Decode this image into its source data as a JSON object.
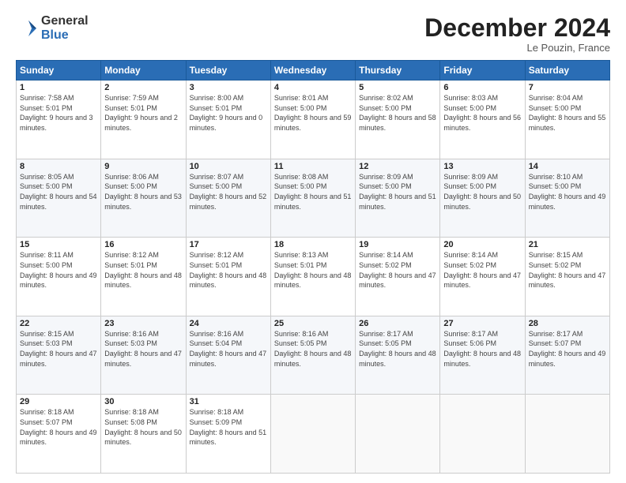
{
  "header": {
    "logo_line1": "General",
    "logo_line2": "Blue",
    "month": "December 2024",
    "location": "Le Pouzin, France"
  },
  "days_of_week": [
    "Sunday",
    "Monday",
    "Tuesday",
    "Wednesday",
    "Thursday",
    "Friday",
    "Saturday"
  ],
  "weeks": [
    [
      {
        "day": 1,
        "sunrise": "7:58 AM",
        "sunset": "5:01 PM",
        "daylight": "9 hours and 3 minutes."
      },
      {
        "day": 2,
        "sunrise": "7:59 AM",
        "sunset": "5:01 PM",
        "daylight": "9 hours and 2 minutes."
      },
      {
        "day": 3,
        "sunrise": "8:00 AM",
        "sunset": "5:01 PM",
        "daylight": "9 hours and 0 minutes."
      },
      {
        "day": 4,
        "sunrise": "8:01 AM",
        "sunset": "5:00 PM",
        "daylight": "8 hours and 59 minutes."
      },
      {
        "day": 5,
        "sunrise": "8:02 AM",
        "sunset": "5:00 PM",
        "daylight": "8 hours and 58 minutes."
      },
      {
        "day": 6,
        "sunrise": "8:03 AM",
        "sunset": "5:00 PM",
        "daylight": "8 hours and 56 minutes."
      },
      {
        "day": 7,
        "sunrise": "8:04 AM",
        "sunset": "5:00 PM",
        "daylight": "8 hours and 55 minutes."
      }
    ],
    [
      {
        "day": 8,
        "sunrise": "8:05 AM",
        "sunset": "5:00 PM",
        "daylight": "8 hours and 54 minutes."
      },
      {
        "day": 9,
        "sunrise": "8:06 AM",
        "sunset": "5:00 PM",
        "daylight": "8 hours and 53 minutes."
      },
      {
        "day": 10,
        "sunrise": "8:07 AM",
        "sunset": "5:00 PM",
        "daylight": "8 hours and 52 minutes."
      },
      {
        "day": 11,
        "sunrise": "8:08 AM",
        "sunset": "5:00 PM",
        "daylight": "8 hours and 51 minutes."
      },
      {
        "day": 12,
        "sunrise": "8:09 AM",
        "sunset": "5:00 PM",
        "daylight": "8 hours and 51 minutes."
      },
      {
        "day": 13,
        "sunrise": "8:09 AM",
        "sunset": "5:00 PM",
        "daylight": "8 hours and 50 minutes."
      },
      {
        "day": 14,
        "sunrise": "8:10 AM",
        "sunset": "5:00 PM",
        "daylight": "8 hours and 49 minutes."
      }
    ],
    [
      {
        "day": 15,
        "sunrise": "8:11 AM",
        "sunset": "5:00 PM",
        "daylight": "8 hours and 49 minutes."
      },
      {
        "day": 16,
        "sunrise": "8:12 AM",
        "sunset": "5:01 PM",
        "daylight": "8 hours and 48 minutes."
      },
      {
        "day": 17,
        "sunrise": "8:12 AM",
        "sunset": "5:01 PM",
        "daylight": "8 hours and 48 minutes."
      },
      {
        "day": 18,
        "sunrise": "8:13 AM",
        "sunset": "5:01 PM",
        "daylight": "8 hours and 48 minutes."
      },
      {
        "day": 19,
        "sunrise": "8:14 AM",
        "sunset": "5:02 PM",
        "daylight": "8 hours and 47 minutes."
      },
      {
        "day": 20,
        "sunrise": "8:14 AM",
        "sunset": "5:02 PM",
        "daylight": "8 hours and 47 minutes."
      },
      {
        "day": 21,
        "sunrise": "8:15 AM",
        "sunset": "5:02 PM",
        "daylight": "8 hours and 47 minutes."
      }
    ],
    [
      {
        "day": 22,
        "sunrise": "8:15 AM",
        "sunset": "5:03 PM",
        "daylight": "8 hours and 47 minutes."
      },
      {
        "day": 23,
        "sunrise": "8:16 AM",
        "sunset": "5:03 PM",
        "daylight": "8 hours and 47 minutes."
      },
      {
        "day": 24,
        "sunrise": "8:16 AM",
        "sunset": "5:04 PM",
        "daylight": "8 hours and 47 minutes."
      },
      {
        "day": 25,
        "sunrise": "8:16 AM",
        "sunset": "5:05 PM",
        "daylight": "8 hours and 48 minutes."
      },
      {
        "day": 26,
        "sunrise": "8:17 AM",
        "sunset": "5:05 PM",
        "daylight": "8 hours and 48 minutes."
      },
      {
        "day": 27,
        "sunrise": "8:17 AM",
        "sunset": "5:06 PM",
        "daylight": "8 hours and 48 minutes."
      },
      {
        "day": 28,
        "sunrise": "8:17 AM",
        "sunset": "5:07 PM",
        "daylight": "8 hours and 49 minutes."
      }
    ],
    [
      {
        "day": 29,
        "sunrise": "8:18 AM",
        "sunset": "5:07 PM",
        "daylight": "8 hours and 49 minutes."
      },
      {
        "day": 30,
        "sunrise": "8:18 AM",
        "sunset": "5:08 PM",
        "daylight": "8 hours and 50 minutes."
      },
      {
        "day": 31,
        "sunrise": "8:18 AM",
        "sunset": "5:09 PM",
        "daylight": "8 hours and 51 minutes."
      },
      null,
      null,
      null,
      null
    ]
  ]
}
